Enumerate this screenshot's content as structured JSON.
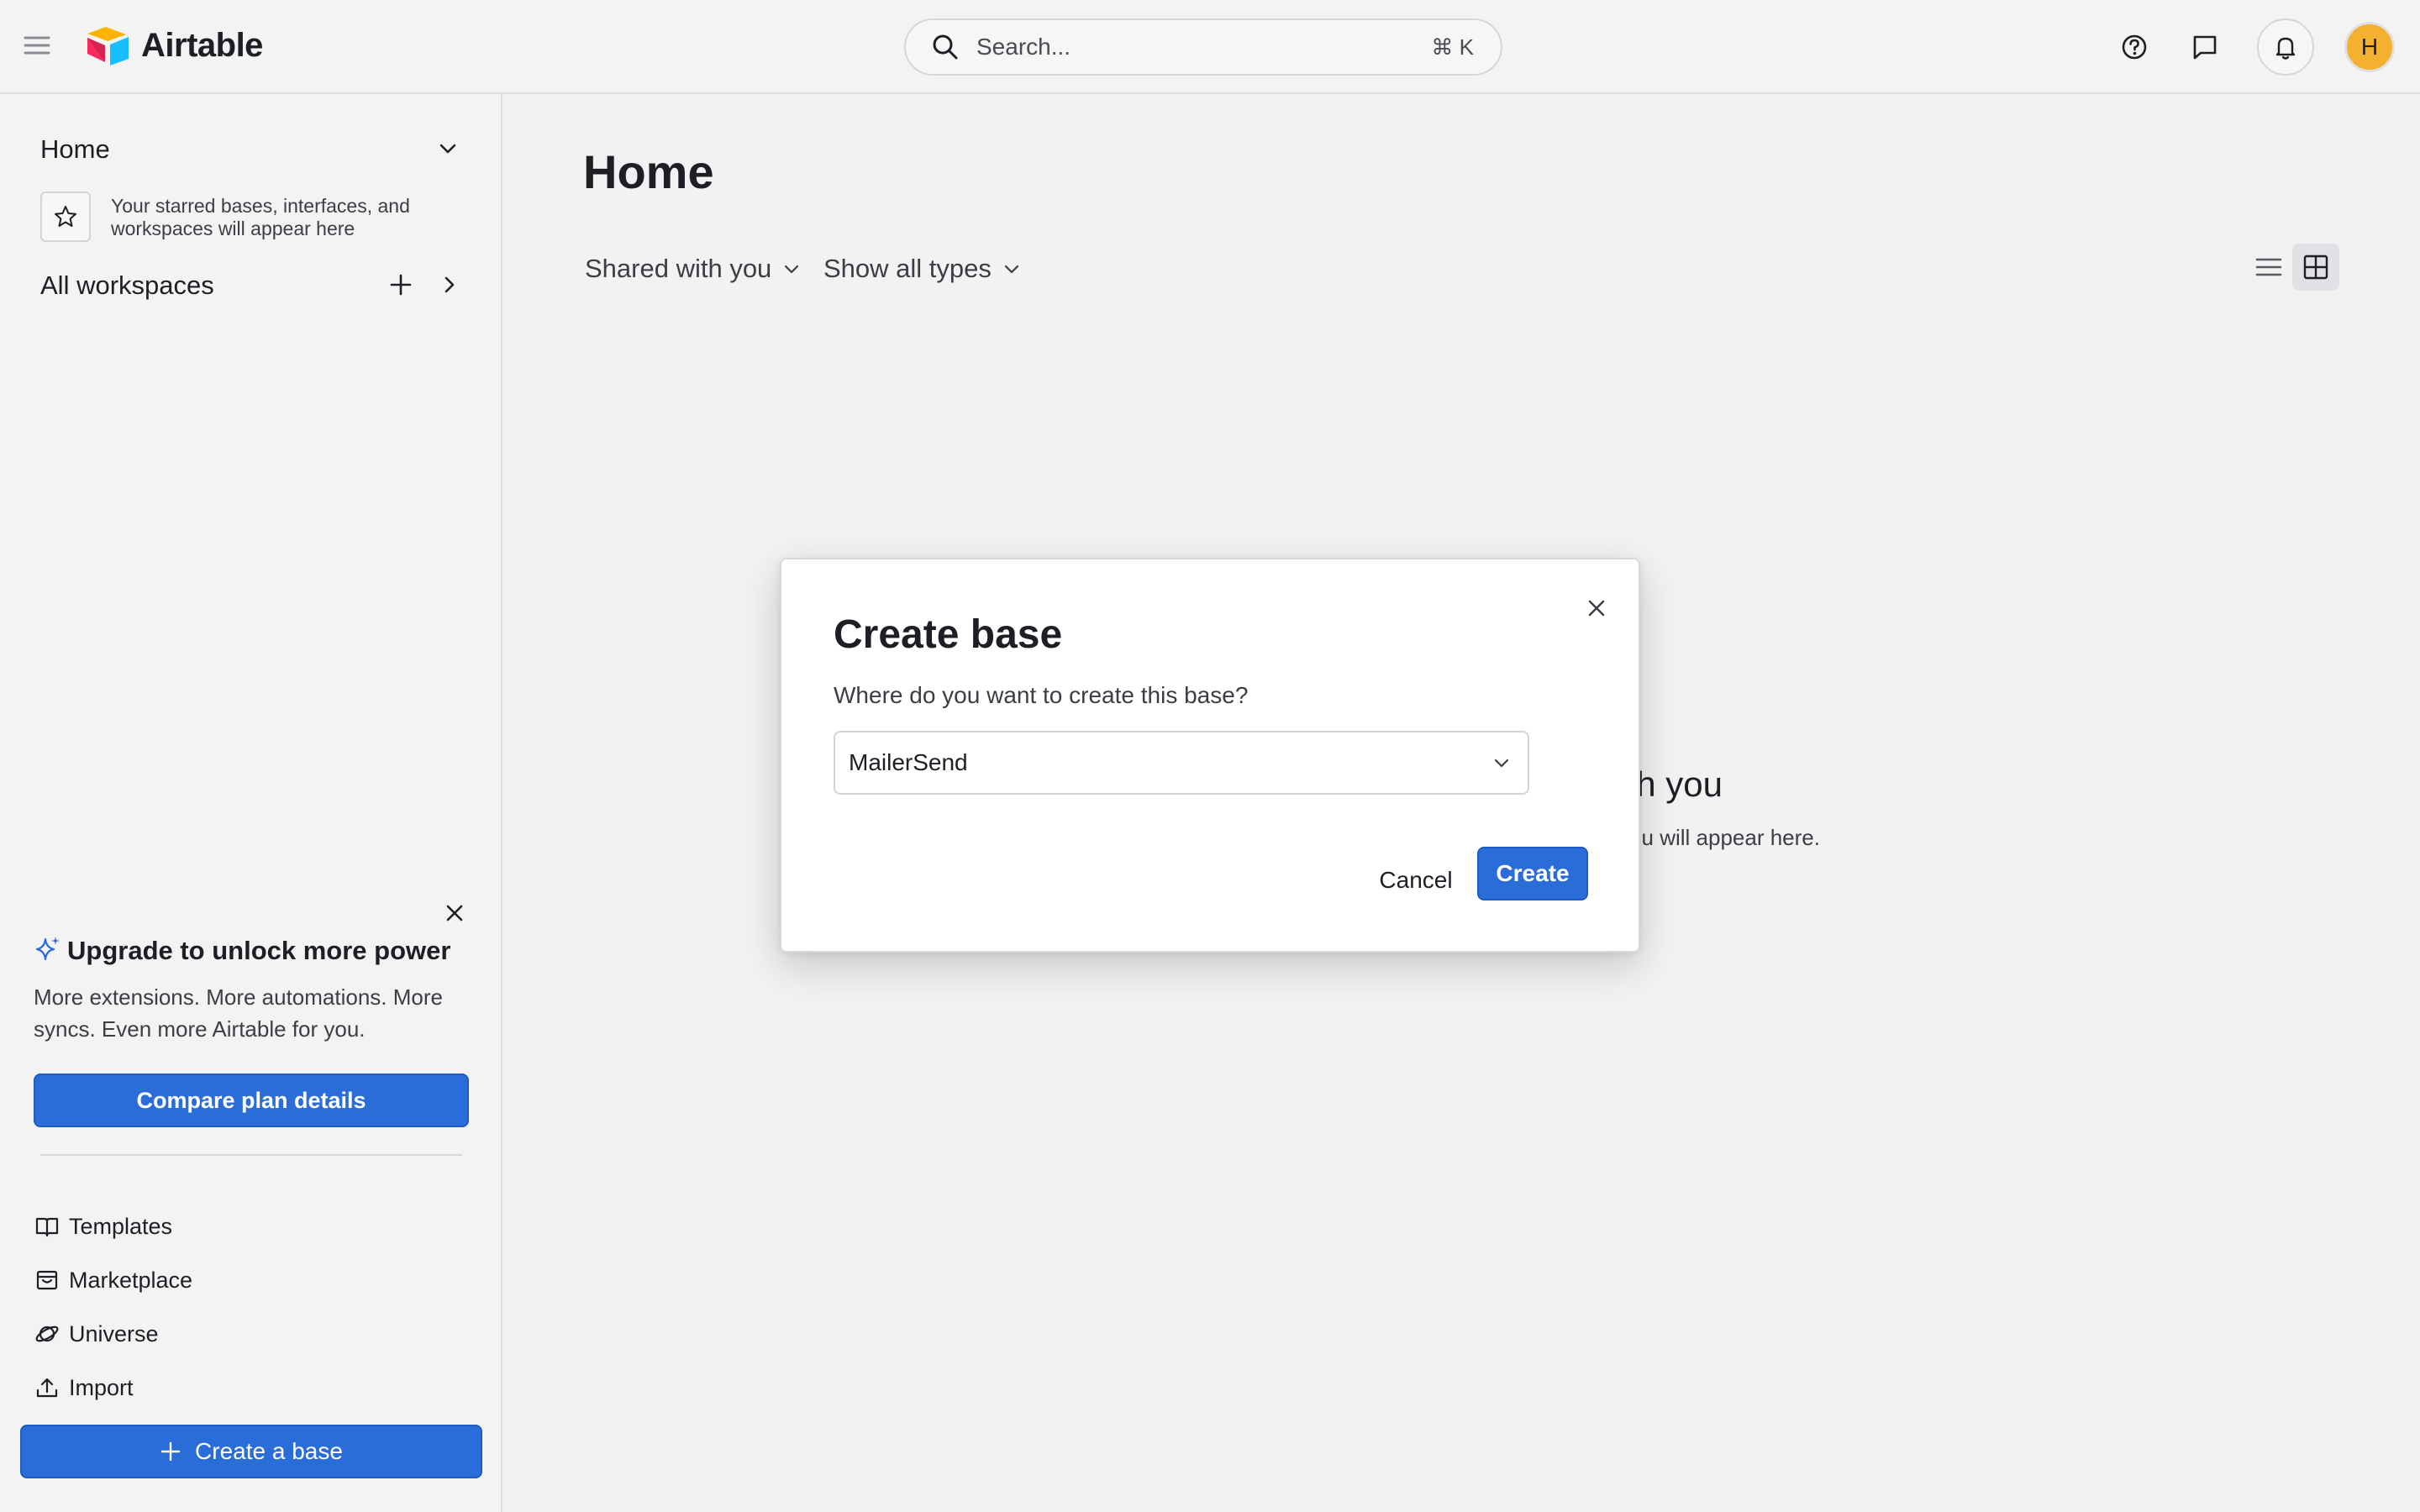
{
  "app": {
    "name": "Airtable",
    "brand_colors": {
      "primary_blue": "#2a6dd9",
      "avatar": "#f3b12f",
      "logo_yellow": "#fcb400",
      "logo_red": "#f82b60",
      "logo_blue": "#18bfff"
    }
  },
  "topbar": {
    "search_placeholder": "Search...",
    "search_shortcut": "⌘ K",
    "icons": [
      "menu-icon",
      "search-icon",
      "help-icon",
      "chat-icon",
      "bell-icon"
    ],
    "avatar_initial": "H"
  },
  "sidebar": {
    "home_label": "Home",
    "starred_empty_text": "Your starred bases, interfaces, and workspaces will appear here",
    "all_workspaces_label": "All workspaces",
    "upgrade": {
      "title": "Upgrade to unlock more power",
      "body": "More extensions. More automations. More syncs. Even more Airtable for you.",
      "button": "Compare plan details"
    },
    "links": [
      {
        "label": "Templates",
        "icon": "book-icon"
      },
      {
        "label": "Marketplace",
        "icon": "marketplace-icon"
      },
      {
        "label": "Universe",
        "icon": "planet-icon"
      },
      {
        "label": "Import",
        "icon": "upload-icon"
      }
    ],
    "create_base_button": "Create a base"
  },
  "main": {
    "title": "Home",
    "filters": {
      "owner": "Shared with you",
      "type": "Show all types"
    },
    "empty_state_title_visible": "h you",
    "empty_state_subtitle_visible": "u will appear here."
  },
  "modal": {
    "title": "Create base",
    "question": "Where do you want to create this base?",
    "selected_workspace": "MailerSend",
    "cancel_label": "Cancel",
    "create_label": "Create"
  }
}
